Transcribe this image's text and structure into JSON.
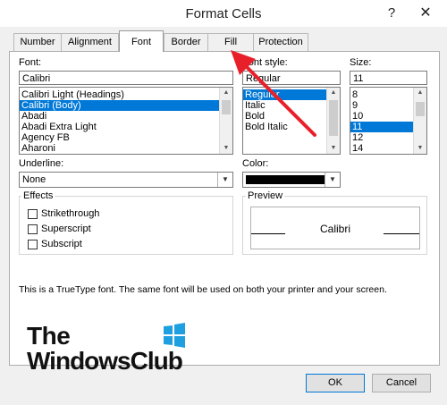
{
  "window": {
    "title": "Format Cells",
    "help": "?",
    "close": "✕"
  },
  "tabs": [
    {
      "label": "Number"
    },
    {
      "label": "Alignment"
    },
    {
      "label": "Font"
    },
    {
      "label": "Border"
    },
    {
      "label": "Fill"
    },
    {
      "label": "Protection"
    }
  ],
  "font": {
    "label": "Font:",
    "value": "Calibri",
    "items": [
      "Calibri Light (Headings)",
      "Calibri (Body)",
      "Abadi",
      "Abadi Extra Light",
      "Agency FB",
      "Aharoni"
    ],
    "selected_index": 1
  },
  "font_style": {
    "label": "Font style:",
    "value": "Regular",
    "items": [
      "Regular",
      "Italic",
      "Bold",
      "Bold Italic"
    ],
    "selected_index": 0
  },
  "size": {
    "label": "Size:",
    "value": "11",
    "items": [
      "8",
      "9",
      "10",
      "11",
      "12",
      "14"
    ],
    "selected_index": 3
  },
  "underline": {
    "label": "Underline:",
    "value": "None"
  },
  "color": {
    "label": "Color:",
    "swatch": "#000000"
  },
  "effects": {
    "label": "Effects",
    "items": [
      {
        "label": "Strikethrough",
        "checked": false
      },
      {
        "label": "Superscript",
        "checked": false
      },
      {
        "label": "Subscript",
        "checked": false
      }
    ]
  },
  "preview": {
    "label": "Preview",
    "text": "Calibri"
  },
  "info_text": "This is a TrueType font.  The same font will be used on both your printer and your screen.",
  "buttons": {
    "ok": "OK",
    "cancel": "Cancel"
  },
  "watermark": {
    "line1": "The",
    "line2": "WindowsClub"
  },
  "colors": {
    "accent": "#0078d7",
    "arrow": "#e8202a"
  }
}
